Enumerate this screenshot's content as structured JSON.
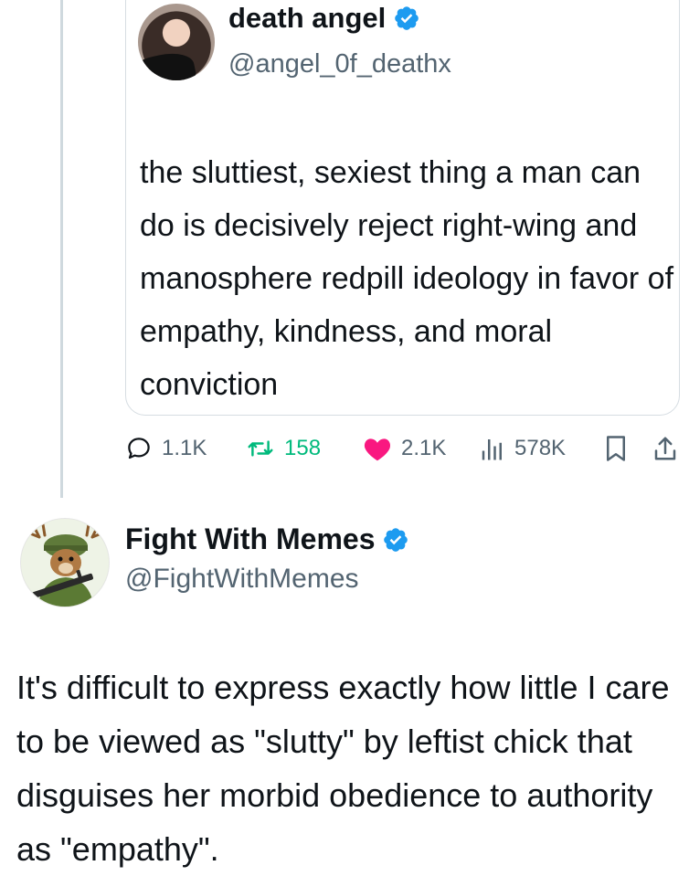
{
  "quoted_tweet": {
    "display_name": "death angel",
    "handle": "@angel_0f_deathx",
    "text": "the sluttiest, sexiest thing a man can do is decisively reject right-wing and manosphere redpill ideology in favor of empathy, kindness, and moral conviction",
    "stats": {
      "replies": "1.1K",
      "retweets": "158",
      "likes": "2.1K",
      "views": "578K"
    }
  },
  "reply_tweet": {
    "display_name": "Fight With Memes",
    "handle": "@FightWithMemes",
    "text": "It's difficult to express exactly how little I care to be viewed as \"slutty\" by leftist chick that disguises her morbid obedience to authority as \"empathy\"."
  },
  "colors": {
    "verified_blue": "#1d9bf0",
    "retweet_green": "#00ba7c",
    "like_red": "#f91880",
    "secondary_text": "#536471"
  },
  "icons": [
    "verified-badge-icon",
    "reply-icon",
    "retweet-icon",
    "like-icon",
    "views-icon",
    "bookmark-icon",
    "share-icon"
  ]
}
